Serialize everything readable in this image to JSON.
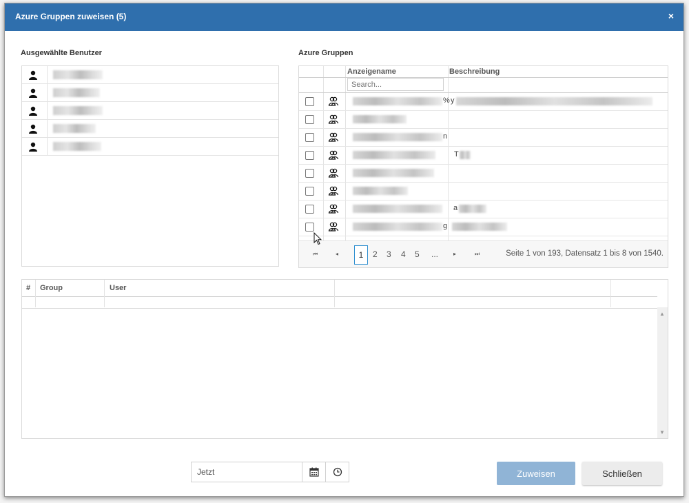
{
  "dialog": {
    "title": "Azure Gruppen zuweisen (5)",
    "close_glyph": "×"
  },
  "users": {
    "label": "Ausgewählte Benutzer",
    "count": 5
  },
  "groups": {
    "label": "Azure Gruppen",
    "columns": {
      "name": "Anzeigename",
      "description": "Beschreibung"
    },
    "search_placeholder": "Search...",
    "row_count": 8,
    "row_fragments": {
      "r0_name_tail": "%",
      "r0_desc_head": "y",
      "r2_name_tail": "n",
      "r3_desc_head": "T",
      "r6_name_tail": "",
      "r6_desc_head": "a",
      "r7_name_tail": "g"
    }
  },
  "pager": {
    "first": "⏮",
    "prev": "◂",
    "next": "▸",
    "last": "⏭",
    "pages": [
      "1",
      "2",
      "3",
      "4",
      "5",
      "..."
    ],
    "current": "1",
    "info": "Seite 1 von 193, Datensatz 1 bis 8 von 1540."
  },
  "assignments": {
    "columns": {
      "num": "#",
      "group": "Group",
      "user": "User"
    }
  },
  "footer": {
    "date_value": "Jetzt",
    "assign_label": "Zuweisen",
    "close_label": "Schließen"
  },
  "colors": {
    "header": "#2f6fad",
    "assign_button": "#90b4d6",
    "page_active_border": "#2f8fd0"
  }
}
